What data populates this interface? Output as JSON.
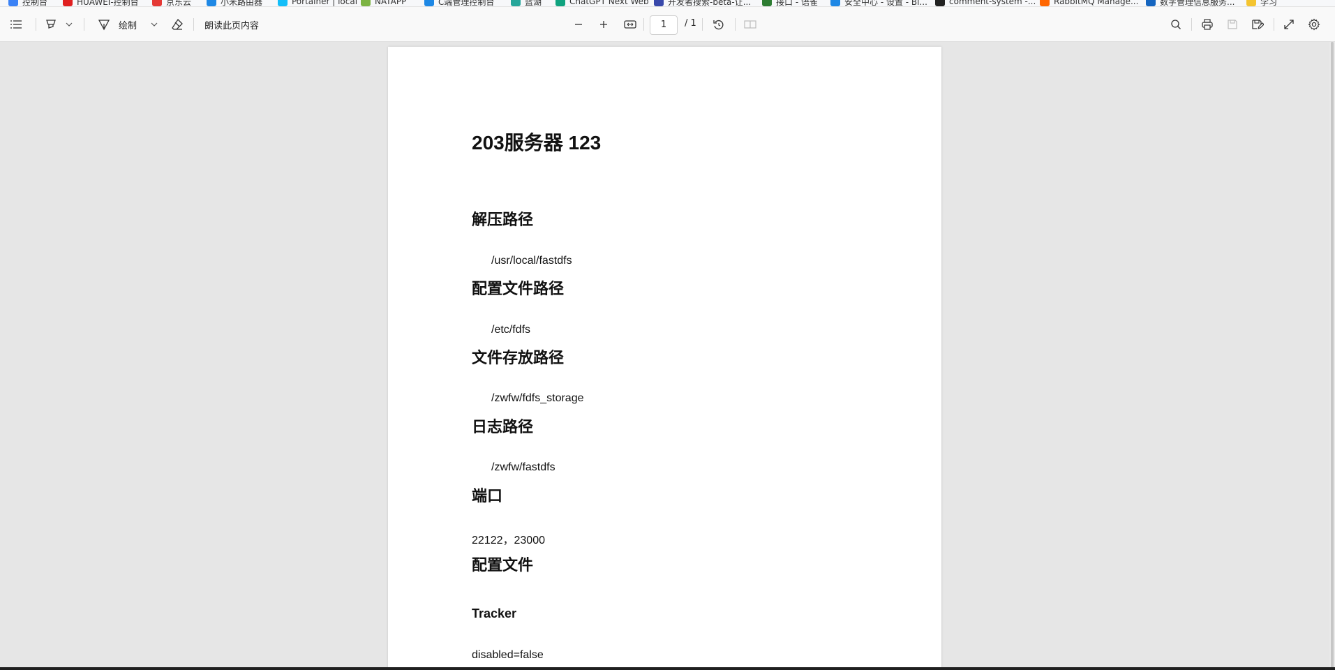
{
  "bookmarks": [
    {
      "label": "控制台",
      "color": "#3b82f6"
    },
    {
      "label": "HUAWEI-控制台",
      "color": "#e02020"
    },
    {
      "label": "京东云",
      "color": "#e53935"
    },
    {
      "label": "小米路由器",
      "color": "#1e88e5"
    },
    {
      "label": "Portainer | local",
      "color": "#13bef9"
    },
    {
      "label": "NATAPP",
      "color": "#7cb342"
    },
    {
      "label": "C端管理控制台",
      "color": "#1e88e5"
    },
    {
      "label": "蓝湖",
      "color": "#26a69a"
    },
    {
      "label": "ChatGPT Next Web",
      "color": "#10a37f"
    },
    {
      "label": "开发者搜索-beta-让...",
      "color": "#3949ab"
    },
    {
      "label": "接口 - 语雀",
      "color": "#2e7d32"
    },
    {
      "label": "安全中心 - 设置 - Bi...",
      "color": "#1e88e5"
    },
    {
      "label": "comment-system -...",
      "color": "#222222"
    },
    {
      "label": "RabbitMQ Manage...",
      "color": "#ff6600"
    },
    {
      "label": "数字管理信息服务...",
      "color": "#1565c0"
    },
    {
      "label": "学习",
      "color": "#f4c430"
    }
  ],
  "toolbar": {
    "draw_label": "绘制",
    "read_aloud_label": "朗读此页内容",
    "page_number": "1",
    "page_total": "/ 1"
  },
  "document": {
    "title": "203服务器  123",
    "sections": [
      {
        "heading": "解压路径",
        "value": "/usr/local/fastdfs"
      },
      {
        "heading": "配置文件路径",
        "value": "/etc/fdfs"
      },
      {
        "heading": "文件存放路径",
        "value": "/zwfw/fdfs_storage"
      },
      {
        "heading": "日志路径",
        "value": "/zwfw/fastdfs"
      },
      {
        "heading": "端口",
        "value": "22122，23000"
      },
      {
        "heading": "配置文件",
        "value": ""
      }
    ],
    "subheading": "Tracker",
    "config_line": "disabled=false"
  },
  "icons": {
    "contents": "list-icon",
    "highlight": "highlighter-icon",
    "draw": "pen-icon",
    "erase": "eraser-icon",
    "zoom_out": "minus-icon",
    "zoom_in": "plus-icon",
    "fit": "fit-width-icon",
    "rotate": "rotate-icon",
    "two_page": "two-page-icon",
    "search": "search-icon",
    "print": "print-icon",
    "save": "save-icon",
    "save_as": "save-as-icon",
    "fullscreen": "fullscreen-icon",
    "settings": "gear-icon"
  }
}
